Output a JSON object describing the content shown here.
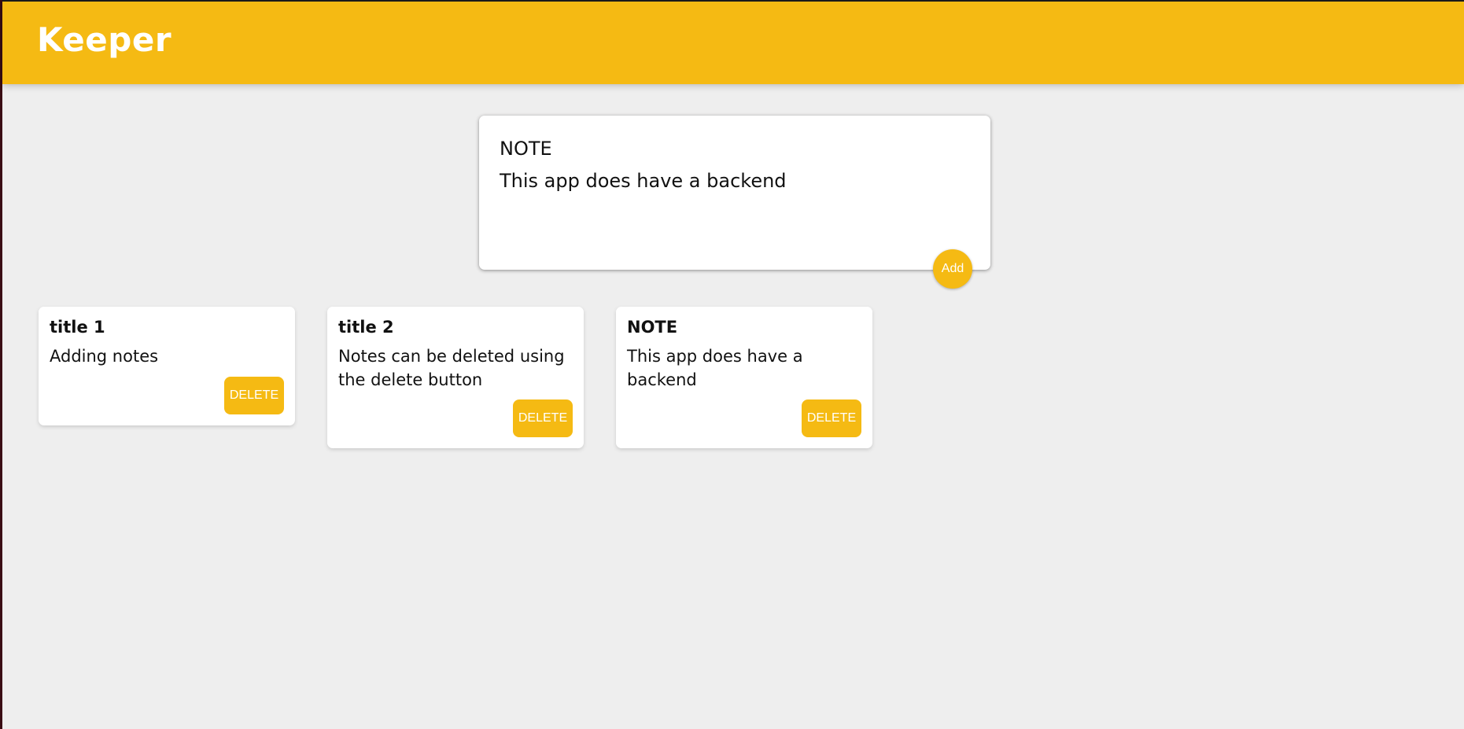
{
  "header": {
    "title": "Keeper"
  },
  "create_note": {
    "title_value": "NOTE",
    "content_value": "This app does have a backend",
    "add_label": "Add"
  },
  "notes": [
    {
      "title": "title 1",
      "content": "Adding notes",
      "delete_label": "DELETE"
    },
    {
      "title": "title 2",
      "content": "Notes can be deleted using the delete button",
      "delete_label": "DELETE"
    },
    {
      "title": "NOTE",
      "content": "This app does have a backend",
      "delete_label": "DELETE"
    }
  ],
  "colors": {
    "accent": "#f5ba13",
    "background": "#eeeeee",
    "card": "#ffffff"
  }
}
